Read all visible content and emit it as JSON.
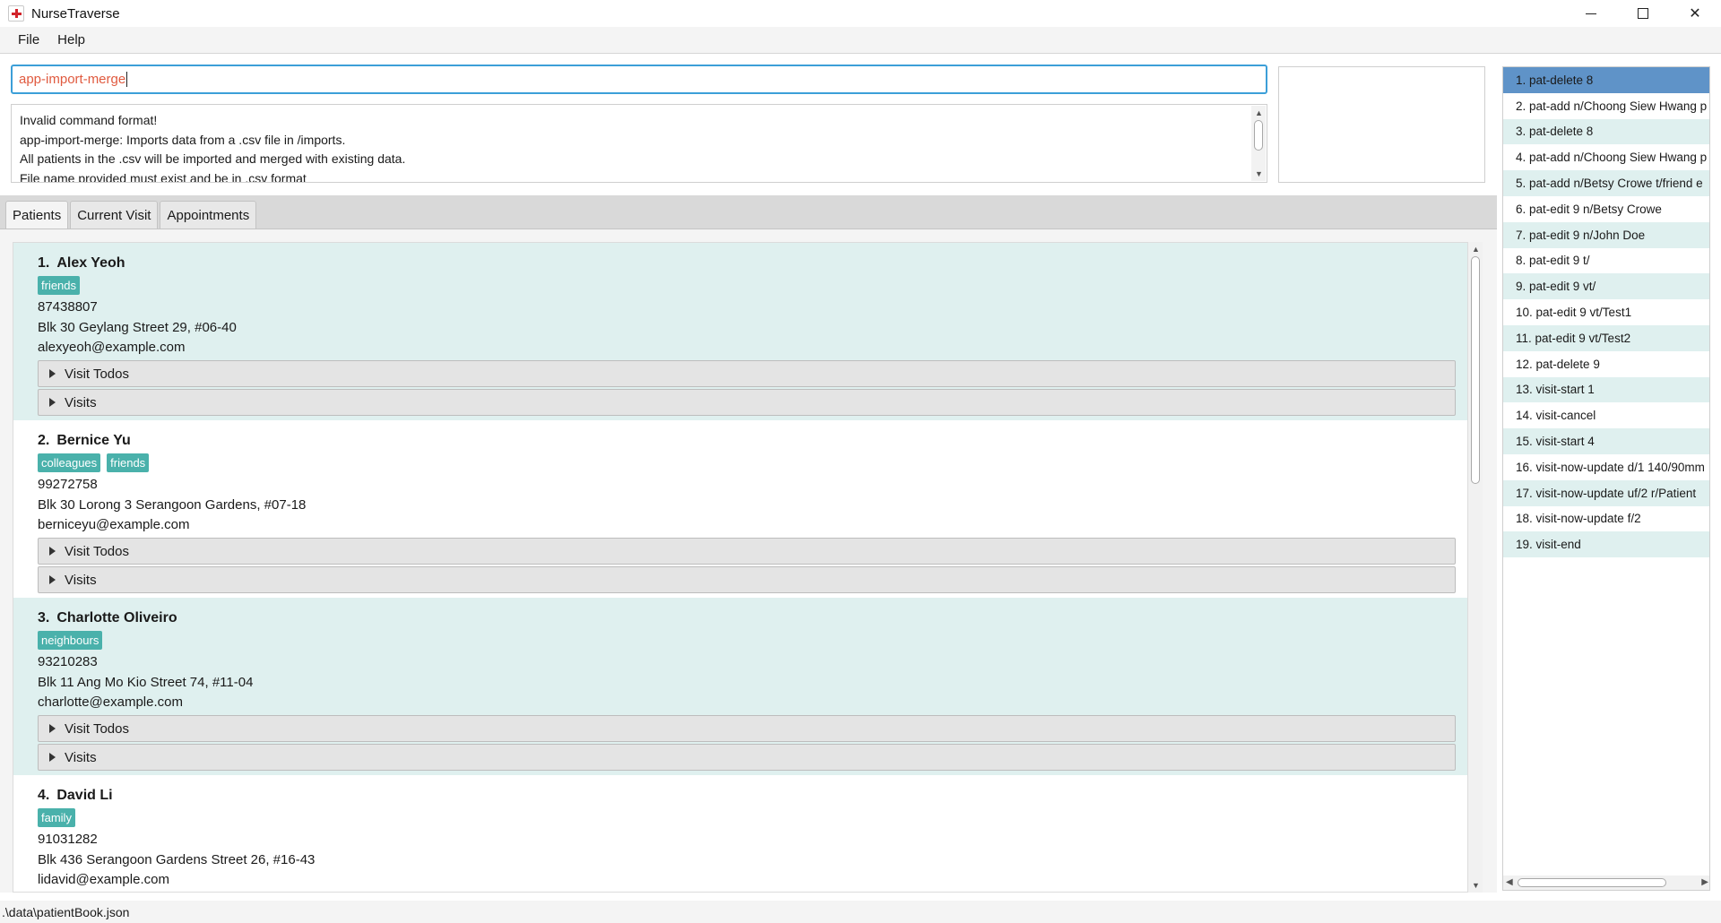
{
  "window": {
    "title": "NurseTraverse",
    "minimize_icon": "minimize-icon",
    "maximize_icon": "maximize-icon",
    "close_symbol": "✕"
  },
  "menu": {
    "file": "File",
    "help": "Help"
  },
  "command_box": {
    "value": "app-import-merge"
  },
  "result_display": {
    "lines": [
      "Invalid command format!",
      "app-import-merge: Imports data from a .csv file in /imports.",
      "All patients in the .csv will be imported and merged with existing data.",
      "File name provided must exist and be in .csv format"
    ]
  },
  "tabs": [
    {
      "label": "Patients",
      "active": true
    },
    {
      "label": "Current Visit",
      "active": false
    },
    {
      "label": "Appointments",
      "active": false
    }
  ],
  "patients": [
    {
      "index": "1.",
      "name": "Alex Yeoh",
      "tags": [
        "friends"
      ],
      "phone": "87438807",
      "address": "Blk 30 Geylang Street 29, #06-40",
      "email": "alexyeoh@example.com"
    },
    {
      "index": "2.",
      "name": "Bernice Yu",
      "tags": [
        "colleagues",
        "friends"
      ],
      "phone": "99272758",
      "address": "Blk 30 Lorong 3 Serangoon Gardens, #07-18",
      "email": "berniceyu@example.com"
    },
    {
      "index": "3.",
      "name": "Charlotte Oliveiro",
      "tags": [
        "neighbours"
      ],
      "phone": "93210283",
      "address": "Blk 11 Ang Mo Kio Street 74, #11-04",
      "email": "charlotte@example.com"
    },
    {
      "index": "4.",
      "name": "David Li",
      "tags": [
        "family"
      ],
      "phone": "91031282",
      "address": "Blk 436 Serangoon Gardens Street 26, #16-43",
      "email": "lidavid@example.com"
    }
  ],
  "expanders": {
    "visit_todos": "Visit Todos",
    "visits": "Visits"
  },
  "history": [
    "1. pat-delete 8",
    "2. pat-add n/Choong Siew Hwang p",
    "3. pat-delete 8",
    "4. pat-add n/Choong Siew Hwang p",
    "5. pat-add n/Betsy Crowe t/friend e",
    "6. pat-edit 9 n/Betsy Crowe",
    "7. pat-edit 9 n/John Doe",
    "8. pat-edit 9 t/",
    "9. pat-edit 9 vt/",
    "10. pat-edit 9 vt/Test1",
    "11. pat-edit 9 vt/Test2",
    "12. pat-delete 9",
    "13. visit-start 1",
    "14. visit-cancel",
    "15. visit-start 4",
    "16. visit-now-update d/1 140/90mm",
    "17. visit-now-update uf/2 r/Patient",
    "18. visit-now-update f/2",
    "19. visit-end"
  ],
  "status_bar": {
    "path": ".\\data\\patientBook.json"
  },
  "colors": {
    "accent": "#3c9fd8",
    "tag": "#4ab1ab",
    "alt_row": "#dff0ef",
    "selected": "#5f93c8",
    "command_text": "#e05a3f"
  }
}
